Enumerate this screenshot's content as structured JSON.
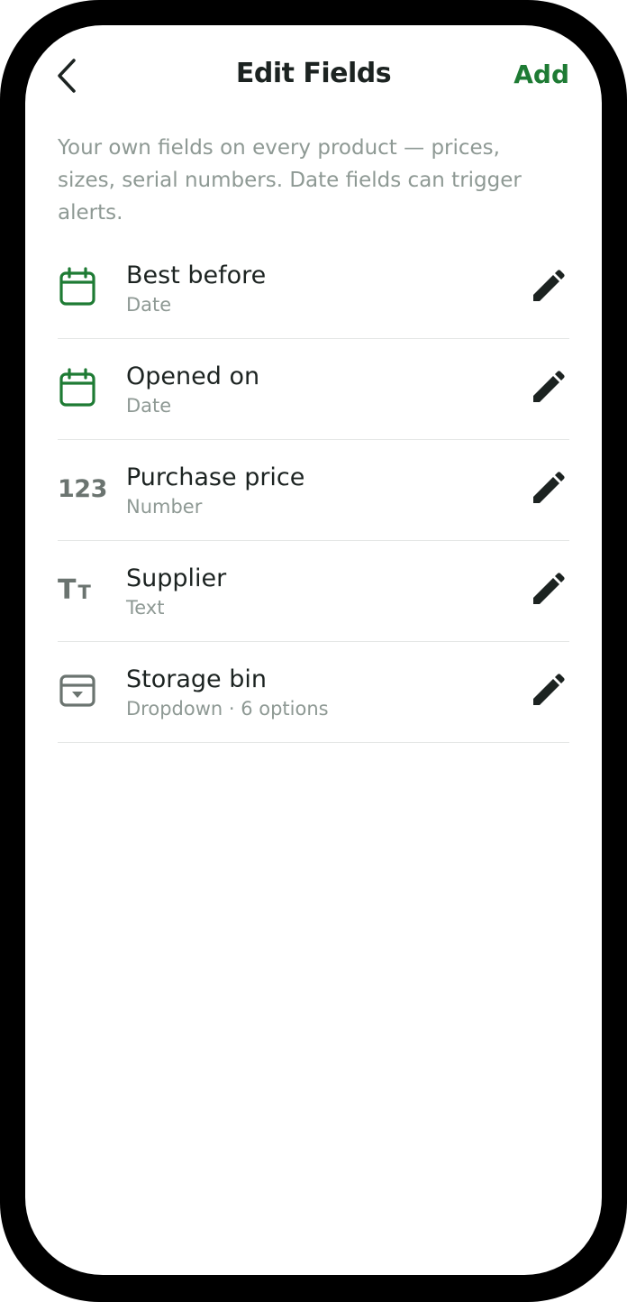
{
  "header": {
    "title": "Edit Fields",
    "add_label": "Add"
  },
  "description": "Your own fields on every product — prices, sizes, serial numbers. Date fields can trigger alerts.",
  "colors": {
    "accent": "#1e7b34",
    "text_primary": "#1c2321",
    "text_secondary": "#8e9994",
    "icon_neutral": "#6b7470"
  },
  "fields": [
    {
      "name": "Best before",
      "type": "Date",
      "icon": "calendar-icon"
    },
    {
      "name": "Opened on",
      "type": "Date",
      "icon": "calendar-icon"
    },
    {
      "name": "Purchase price",
      "type": "Number",
      "icon": "number-icon",
      "icon_text": "123"
    },
    {
      "name": "Supplier",
      "type": "Text",
      "icon": "text-icon",
      "icon_text_large": "T",
      "icon_text_small": "T"
    },
    {
      "name": "Storage bin",
      "type": "Dropdown · 6 options",
      "icon": "dropdown-icon"
    }
  ]
}
